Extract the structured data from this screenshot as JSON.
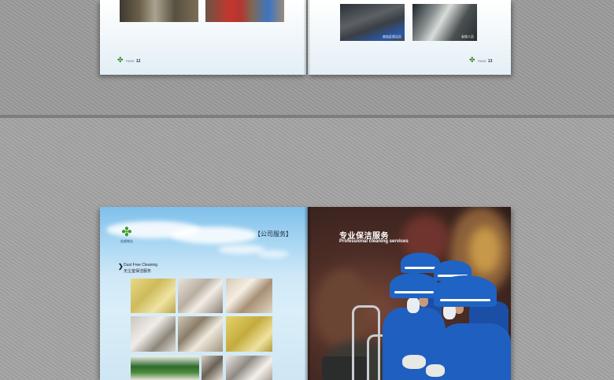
{
  "top_spread": {
    "left_page": {
      "page_label": "PAGE",
      "page_number": "12",
      "photos": [
        "equipment-room-photo",
        "fire-pump-room-photo"
      ]
    },
    "right_page": {
      "page_label": "PAGE",
      "page_number": "13",
      "photos": [
        {
          "name": "worker-cleaning-photo",
          "caption": "商务区保洁员"
        },
        {
          "name": "security-guard-photo",
          "caption": "安保人员"
        }
      ]
    }
  },
  "bottom_spread": {
    "left_page": {
      "logo_text": "宏顺物业",
      "section_tag": "【公司服务】",
      "section_dots": "· · · · ·",
      "service_title_arrow": "❯",
      "service_title_en": "Dust Free Cleaning",
      "service_title_zh": "无尘室保洁服务",
      "grid_photos": [
        "ceiling-cleaning-photo",
        "kitchen-cleaning-photo",
        "wall-wiping-photo",
        "glove-inspection-photo",
        "floor-scrubbing-photo",
        "yellow-room-photo",
        "garden-photo",
        "worker-standing-photo",
        "room-cleaning-photo"
      ]
    },
    "right_page": {
      "title_zh": "专业保洁服务",
      "title_en": "Professional cleaning services"
    }
  },
  "colors": {
    "background": "#9a9a9a",
    "sky_blue": "#7fc0eb",
    "uniform_blue": "#1f63c4",
    "logo_green": "#3f9b2f"
  }
}
